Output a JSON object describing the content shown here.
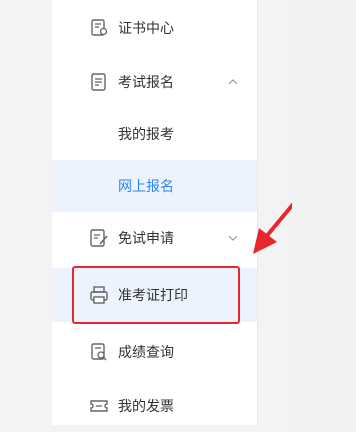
{
  "colors": {
    "accent": "#2f86f6",
    "highlight": "#e8262e",
    "selected_bg": "#ecf3fd"
  },
  "menu": [
    {
      "label": "证书中心",
      "icon": "certificate-doc-icon"
    },
    {
      "label": "考试报名",
      "icon": "document-list-icon",
      "chevron": "chevron-up-icon"
    },
    {
      "label": "我的报考"
    },
    {
      "label": "网上报名"
    },
    {
      "label": "免试申请",
      "icon": "edit-doc-icon",
      "chevron": "chevron-down-icon"
    },
    {
      "label": "准考证打印",
      "icon": "printer-icon"
    },
    {
      "label": "成绩查询",
      "icon": "search-doc-icon"
    },
    {
      "label": "我的发票",
      "icon": "invoice-ticket-icon"
    }
  ]
}
